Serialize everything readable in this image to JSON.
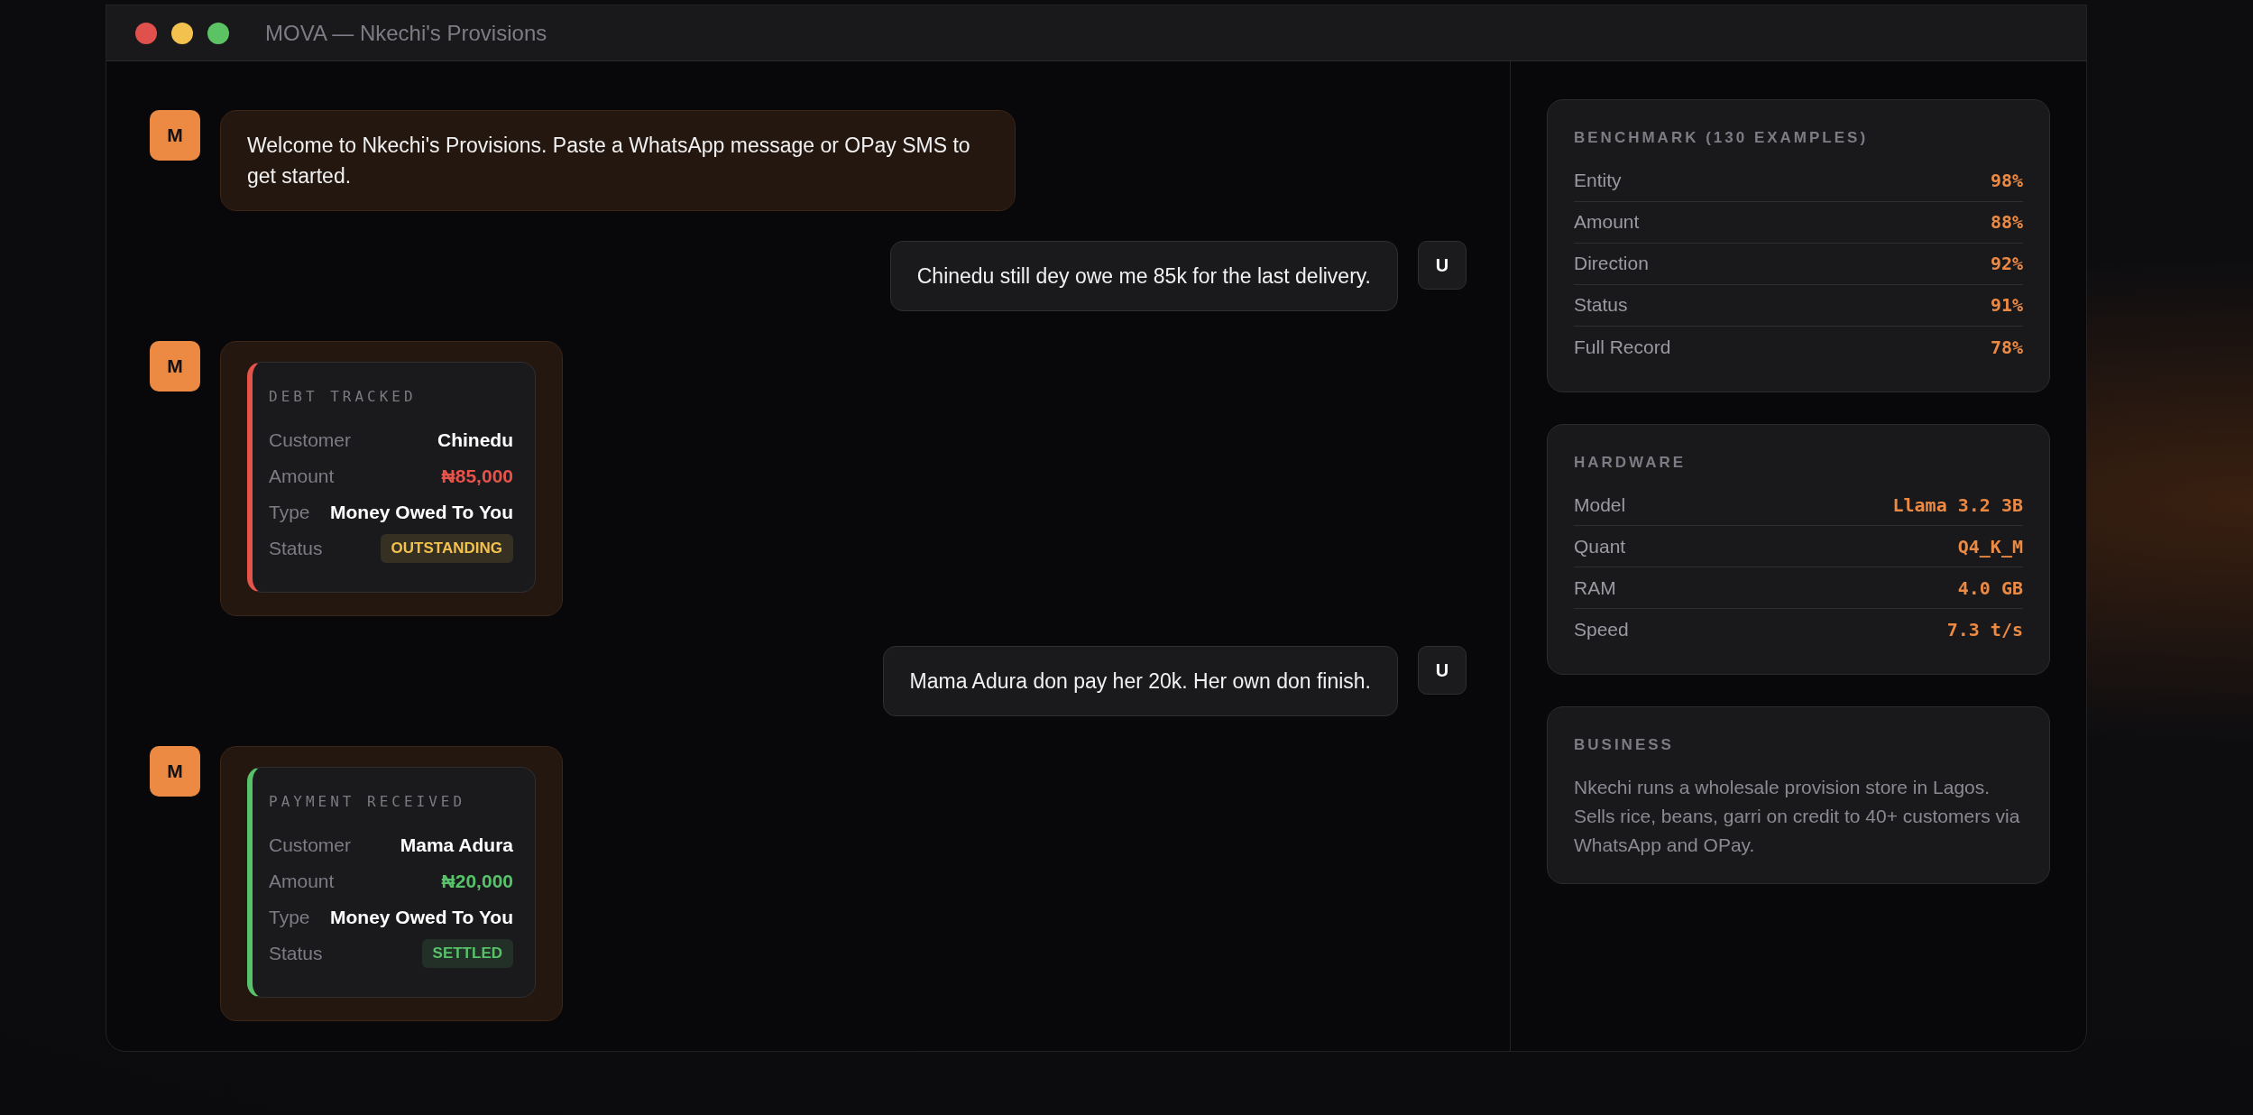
{
  "window": {
    "title": "MOVA — Nkechi's Provisions"
  },
  "messages": [
    {
      "kind": "text",
      "outgoing": false,
      "avatar": "M",
      "text": "Welcome to Nkechi's Provisions. Paste a WhatsApp message or OPay SMS to get started."
    },
    {
      "kind": "text",
      "outgoing": true,
      "avatar": "U",
      "text": "Chinedu still dey owe me 85k for the last delivery."
    },
    {
      "kind": "record",
      "outgoing": false,
      "avatar": "M",
      "title": "DEBT TRACKED",
      "color": "#e5534b",
      "fields": [
        {
          "label": "Customer",
          "value": "Chinedu"
        },
        {
          "label": "Amount",
          "value": "₦85,000",
          "kind": "amount"
        },
        {
          "label": "Type",
          "value": "Money Owed To You"
        }
      ],
      "status": {
        "label": "Status",
        "value": "OUTSTANDING",
        "color": "#f2c14e"
      }
    },
    {
      "kind": "text",
      "outgoing": true,
      "avatar": "U",
      "text": "Mama Adura don pay her 20k. Her own don finish."
    },
    {
      "kind": "record",
      "outgoing": false,
      "avatar": "M",
      "title": "PAYMENT RECEIVED",
      "color": "#57c26a",
      "fields": [
        {
          "label": "Customer",
          "value": "Mama Adura"
        },
        {
          "label": "Amount",
          "value": "₦20,000",
          "kind": "amount"
        },
        {
          "label": "Type",
          "value": "Money Owed To You"
        }
      ],
      "status": {
        "label": "Status",
        "value": "SETTLED",
        "color": "#57c26a"
      }
    }
  ],
  "sidebar": [
    {
      "kind": "table",
      "title": "BENCHMARK (130 EXAMPLES)",
      "rows": [
        {
          "label": "Entity",
          "value": "98%"
        },
        {
          "label": "Amount",
          "value": "88%"
        },
        {
          "label": "Direction",
          "value": "92%"
        },
        {
          "label": "Status",
          "value": "91%"
        },
        {
          "label": "Full Record",
          "value": "78%"
        }
      ]
    },
    {
      "kind": "table",
      "title": "HARDWARE",
      "rows": [
        {
          "label": "Model",
          "value": "Llama 3.2 3B"
        },
        {
          "label": "Quant",
          "value": "Q4_K_M"
        },
        {
          "label": "RAM",
          "value": "4.0 GB"
        },
        {
          "label": "Speed",
          "value": "7.3 t/s"
        }
      ]
    },
    {
      "kind": "text",
      "title": "BUSINESS",
      "text": "Nkechi runs a wholesale provision store in Lagos. Sells rice, beans, garri on credit to 40+ customers via WhatsApp and OPay."
    }
  ]
}
